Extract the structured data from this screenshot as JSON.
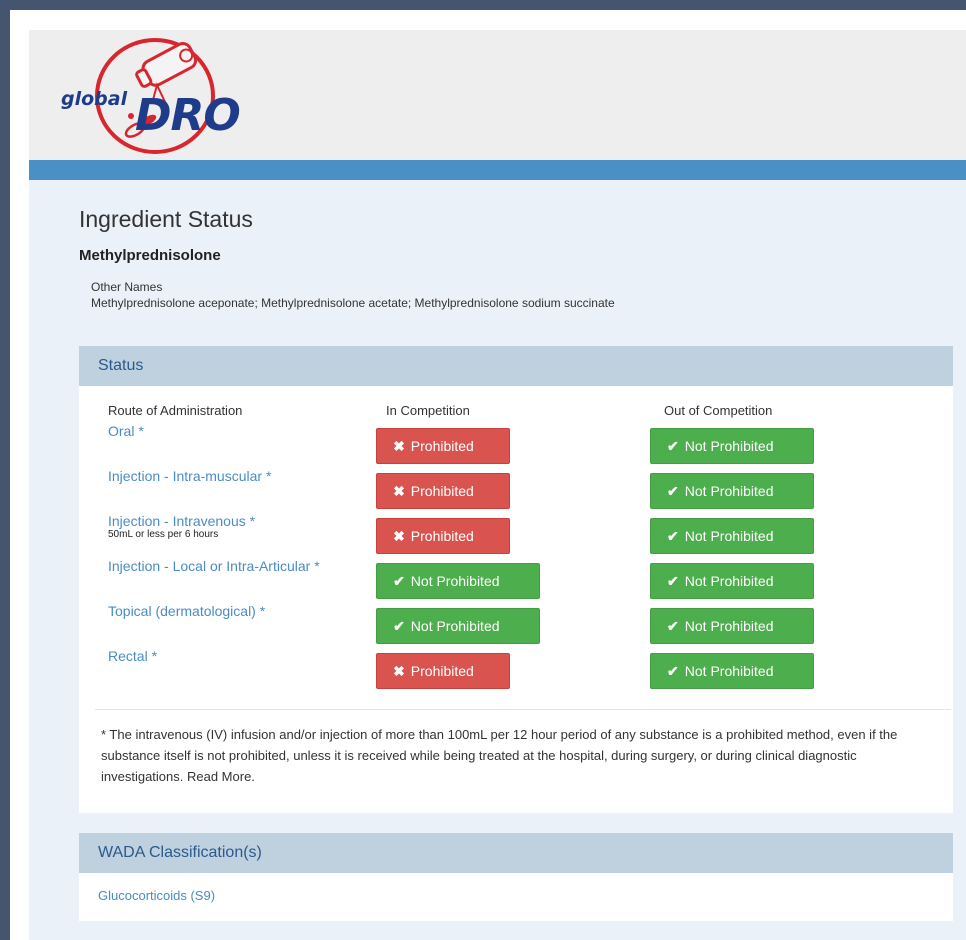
{
  "logo": {
    "global": "global",
    "dro": "DRO"
  },
  "title": "Ingredient Status",
  "ingredient": "Methylprednisolone",
  "other_names": {
    "label": "Other Names",
    "value": "Methylprednisolone aceponate; Methylprednisolone acetate; Methylprednisolone sodium succinate"
  },
  "status": {
    "heading": "Status",
    "col_route": "Route of Administration",
    "col_in": "In Competition",
    "col_out": "Out of Competition",
    "rows": [
      {
        "route": "Oral  *",
        "note": "",
        "in": "Prohibited",
        "out": "Not Prohibited"
      },
      {
        "route": "Injection - Intra-muscular  *",
        "note": "",
        "in": "Prohibited",
        "out": "Not Prohibited"
      },
      {
        "route": "Injection - Intravenous  *",
        "note": "50mL or less per 6 hours",
        "in": "Prohibited",
        "out": "Not Prohibited"
      },
      {
        "route": "Injection - Local or Intra-Articular *",
        "note": "",
        "in": "Not Prohibited",
        "out": "Not Prohibited"
      },
      {
        "route": "Topical (dermatological)  *",
        "note": "",
        "in": "Not Prohibited",
        "out": "Not Prohibited"
      },
      {
        "route": "Rectal  *",
        "note": "",
        "in": "Prohibited",
        "out": "Not Prohibited"
      }
    ],
    "footnote": "* The intravenous (IV) infusion and/or injection of more than 100mL per 12 hour period of any substance is a prohibited method, even if the substance itself is not prohibited, unless it is received while being treated at the hospital, during surgery, or during clinical diagnostic investigations. Read More."
  },
  "wada": {
    "heading": "WADA Classification(s)",
    "item": "Glucocorticoids (S9)"
  },
  "colors": {
    "prohibited": "#d9534f",
    "not_prohibited": "#4cae4c",
    "link": "#4a8cc4",
    "header_bar": "#4a90c4"
  }
}
